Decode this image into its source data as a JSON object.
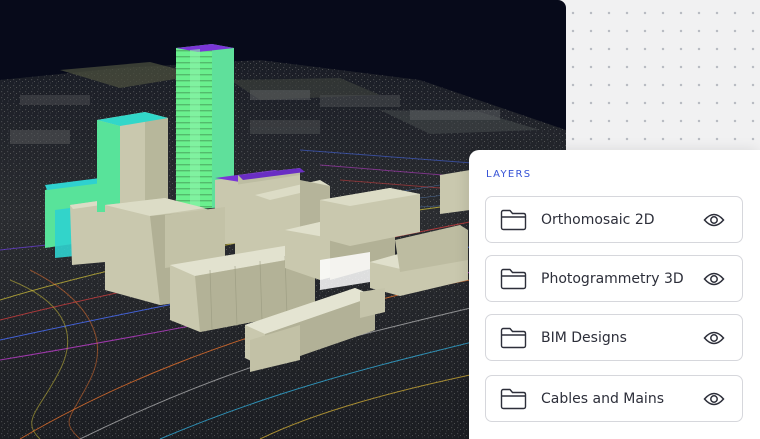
{
  "viewer": {
    "scene": "3D city point cloud with BIM building models and utility lines"
  },
  "layers_panel": {
    "heading": "LAYERS",
    "items": [
      {
        "label": "Orthomosaic 2D",
        "icon": "folder-icon",
        "toggle_icon": "eye-icon",
        "visible": true
      },
      {
        "label": "Photogrammetry 3D",
        "icon": "folder-icon",
        "toggle_icon": "eye-icon",
        "visible": true
      },
      {
        "label": "BIM Designs",
        "icon": "folder-icon",
        "toggle_icon": "eye-icon",
        "visible": true
      },
      {
        "label": "Cables and Mains",
        "icon": "folder-icon",
        "toggle_icon": "eye-icon",
        "visible": true
      }
    ]
  },
  "colors": {
    "accent": "#3552d6",
    "scene_background": "#070a1a",
    "building": "#c9c8ae",
    "tower_highlight": "#6af08e",
    "tower_cyan": "#32d7c9",
    "tower_purple": "#7a36d6"
  }
}
